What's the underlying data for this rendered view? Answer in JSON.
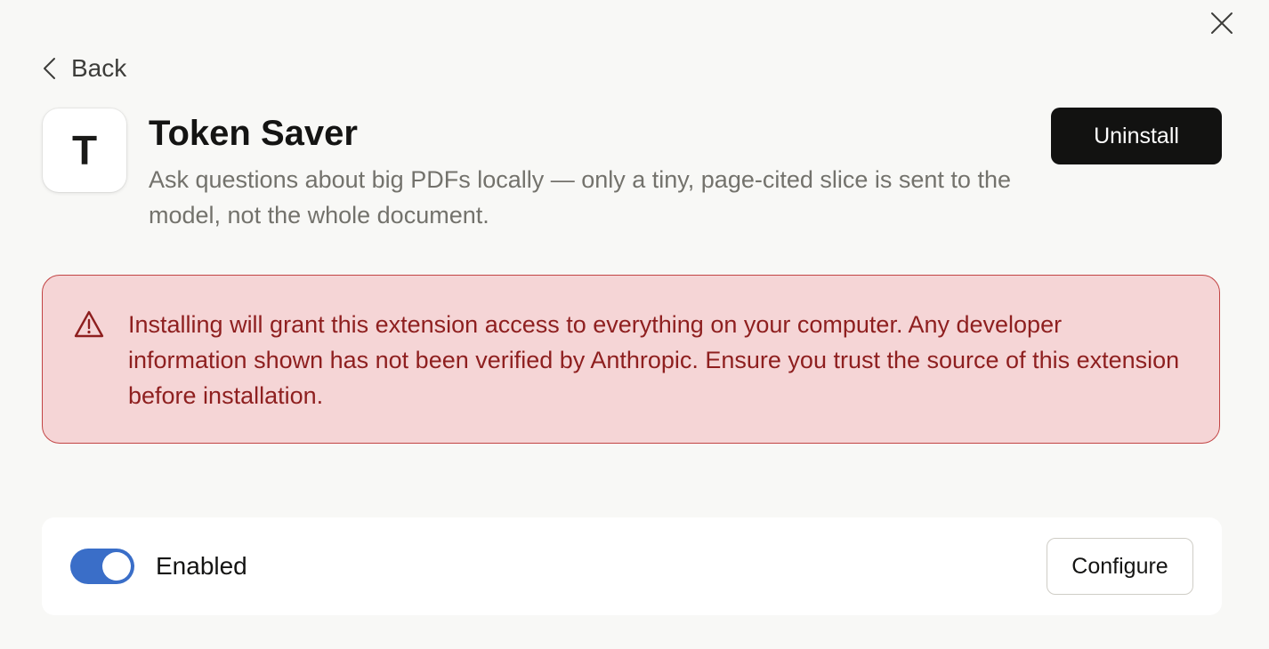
{
  "header": {
    "back_label": "Back",
    "close_icon": "close-icon"
  },
  "extension": {
    "icon_letter": "T",
    "title": "Token Saver",
    "description": "Ask questions about big PDFs locally — only a tiny, page-cited slice is sent to the model, not the whole document.",
    "uninstall_label": "Uninstall"
  },
  "warning": {
    "icon": "warning-triangle-icon",
    "text": "Installing will grant this extension access to everything on your computer. Any developer information shown has not been verified by Anthropic. Ensure you trust the source of this extension before installation."
  },
  "settings": {
    "enabled": true,
    "enabled_label": "Enabled",
    "configure_label": "Configure"
  },
  "colors": {
    "background": "#f8f8f6",
    "primary_button": "#121211",
    "warning_bg": "#f5d5d6",
    "warning_border": "#c24444",
    "warning_text": "#8e1f1f",
    "toggle_on": "#3a6ec8"
  }
}
